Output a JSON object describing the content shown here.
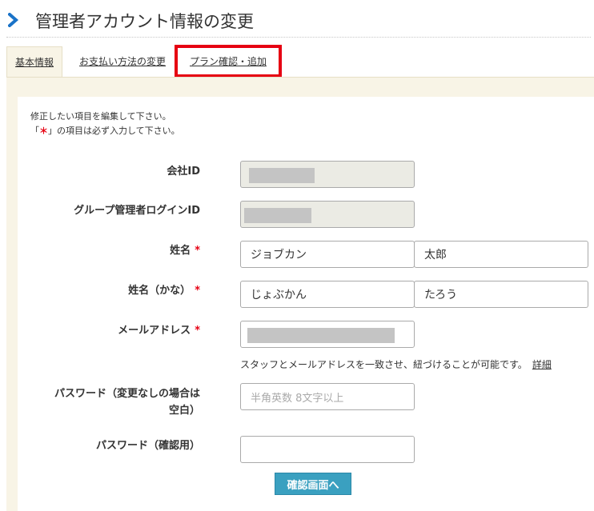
{
  "page": {
    "title": "管理者アカウント情報の変更"
  },
  "tabs": [
    {
      "label": "基本情報",
      "active": true
    },
    {
      "label": "お支払い方法の変更",
      "active": false
    },
    {
      "label": "プラン確認・追加",
      "active": false,
      "highlighted": true
    }
  ],
  "notes": {
    "line1": "修正したい項目を編集して下さい。",
    "line2_prefix": "「",
    "line2_mark": "＊",
    "line2_suffix": "」の項目は必ず入力して下さい。"
  },
  "form": {
    "company_id": {
      "label": "会社ID"
    },
    "group_login_id": {
      "label": "グループ管理者ログインID"
    },
    "name": {
      "label": "姓名",
      "required_mark": "*",
      "last": "ジョブカン",
      "first": "太郎"
    },
    "name_kana": {
      "label": "姓名（かな）",
      "required_mark": "*",
      "last": "じょぶかん",
      "first": "たろう"
    },
    "email": {
      "label": "メールアドレス",
      "required_mark": "*",
      "help": "スタッフとメールアドレスを一致させ、紐づけることが可能です。",
      "help_link": "詳細"
    },
    "password": {
      "label_line1": "パスワード（変更なしの場合は",
      "label_line2": "空白）",
      "placeholder": "半角英数 8文字以上"
    },
    "password_confirm": {
      "label": "パスワード（確認用）"
    }
  },
  "submit": {
    "label": "確認画面へ"
  },
  "colors": {
    "required": "#e60012",
    "accent": "#1a73c8",
    "button": "#3aa0c0",
    "panel": "#f8f4e6"
  },
  "icons": {
    "header": "chevron-right-icon"
  }
}
